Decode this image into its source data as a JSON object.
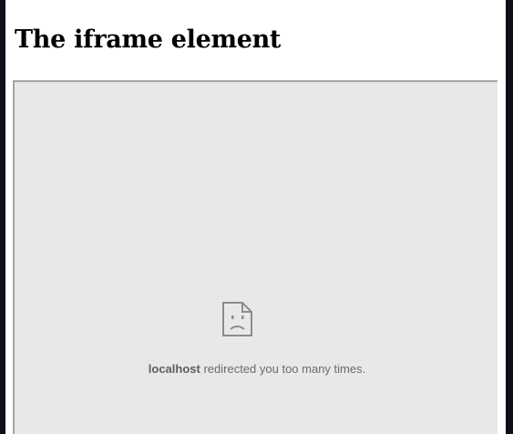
{
  "page": {
    "title": "The iframe element"
  },
  "iframe": {
    "error": {
      "host": "localhost",
      "message": "redirected you too many times."
    },
    "icon": "sad-page-icon"
  },
  "colors": {
    "frame_background": "#e8e8e8",
    "frame_border": "#a3a3a3",
    "error_text": "#6b6b6b",
    "outer_dark": "#0d1117"
  }
}
